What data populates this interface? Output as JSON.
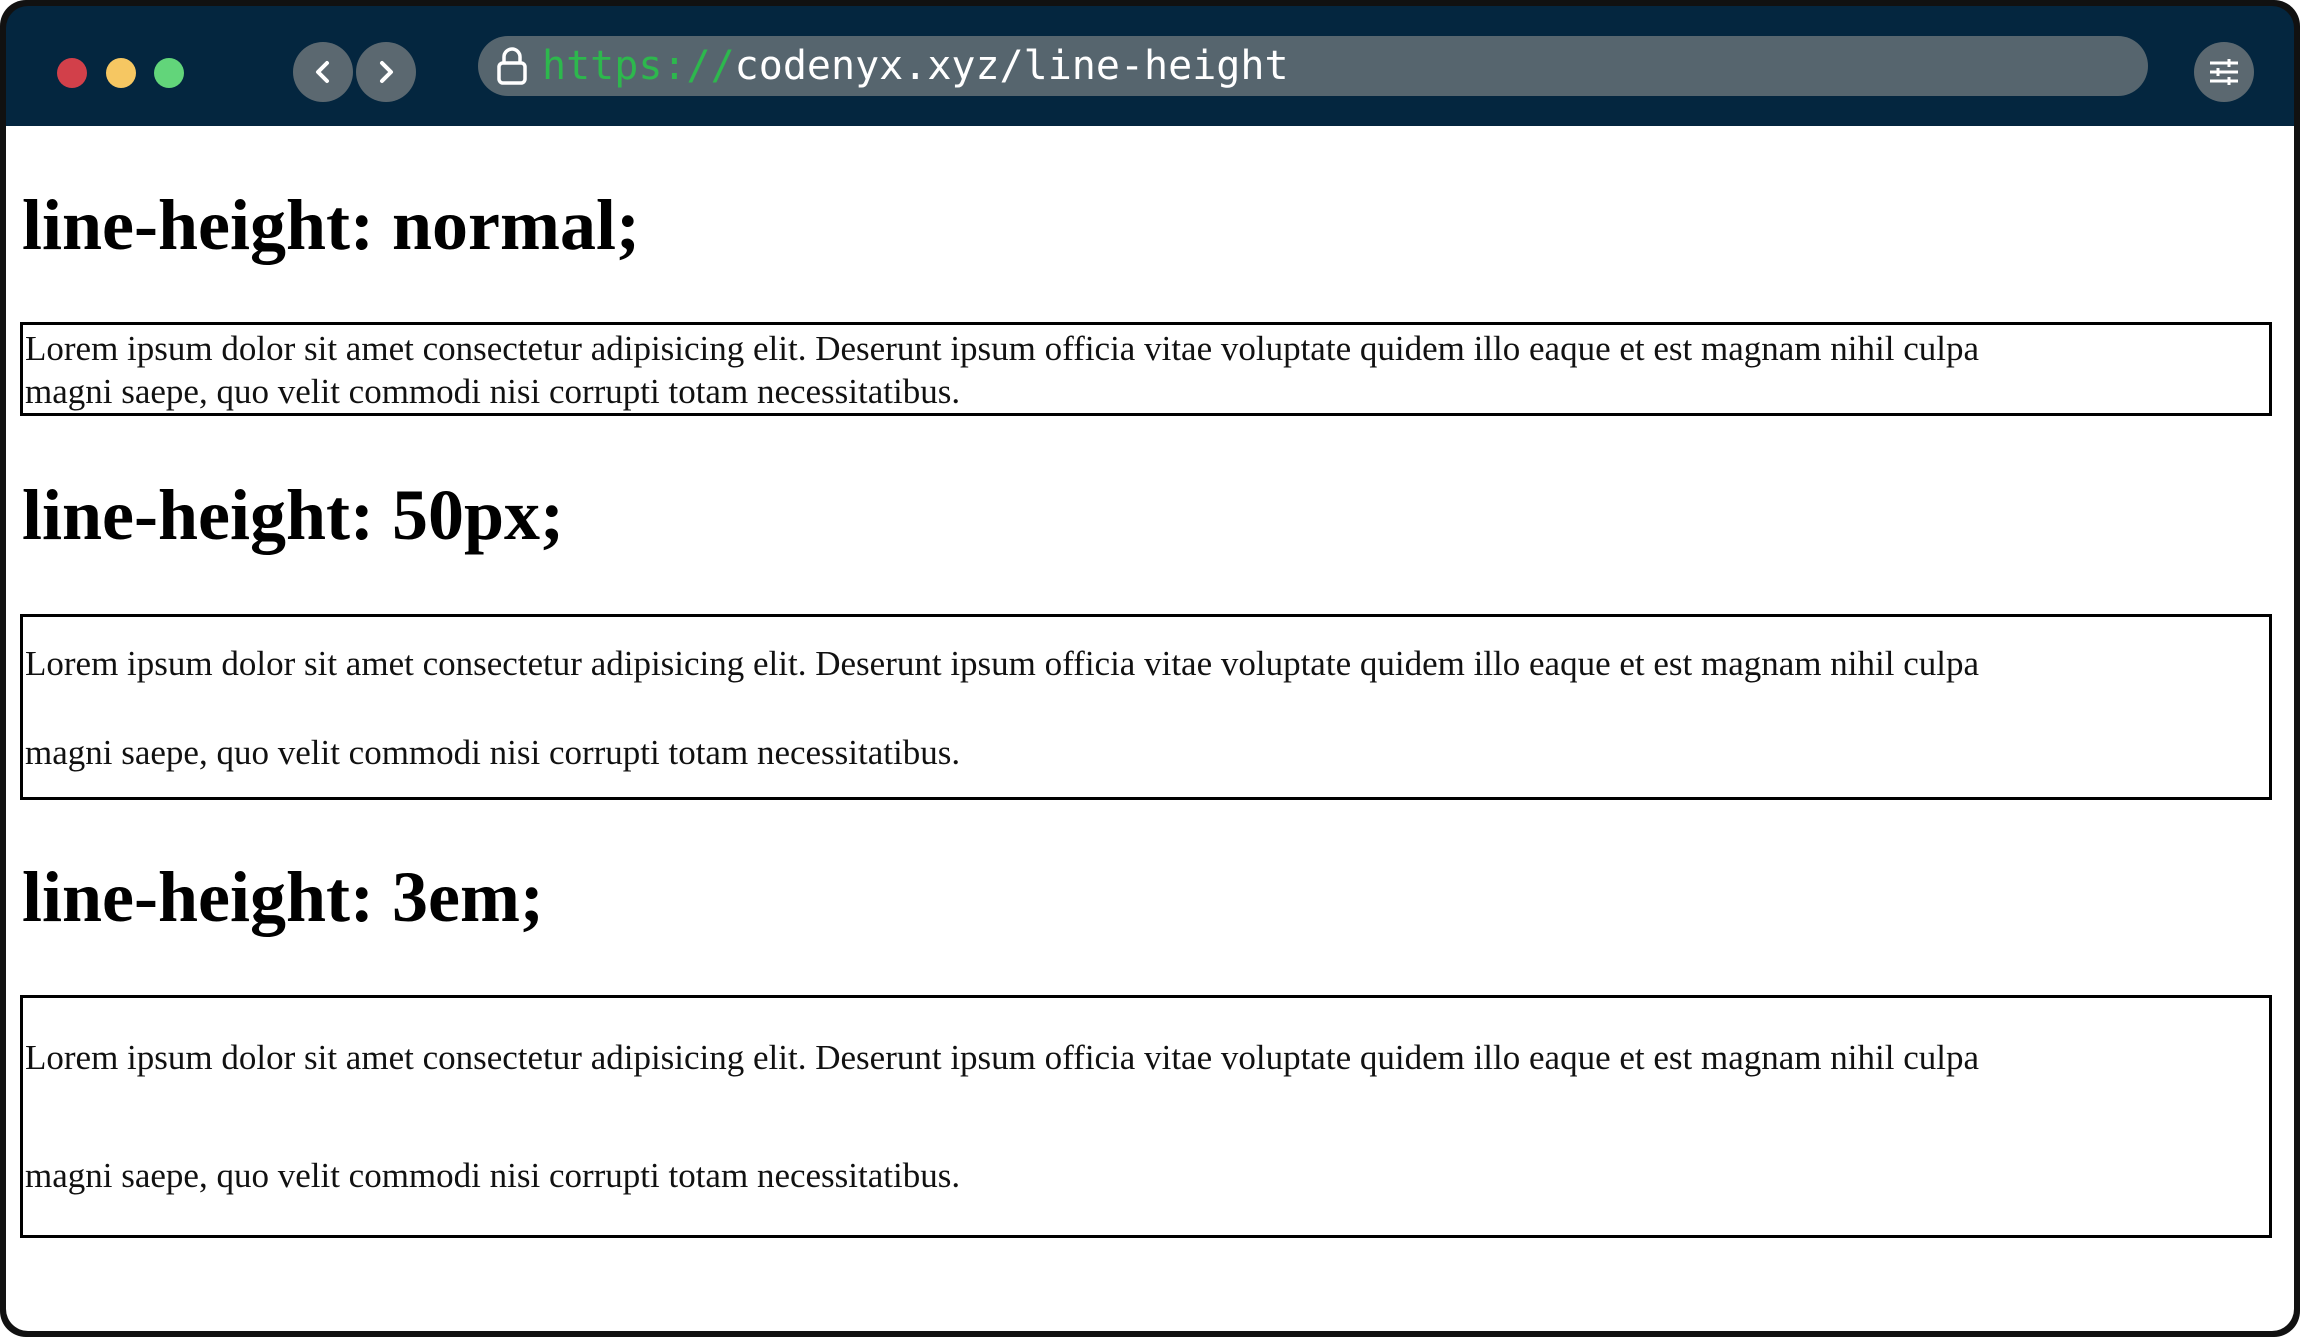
{
  "browser": {
    "url_scheme": "https://",
    "url_rest": "codenyx.xyz/line-height",
    "icons": [
      "back-icon",
      "forward-icon",
      "lock-icon",
      "settings-sliders-icon"
    ],
    "traffic_light_colors": [
      "#d2404a",
      "#f6c762",
      "#62d57a"
    ]
  },
  "sections": [
    {
      "heading": "line-height: normal;",
      "line1": "Lorem ipsum dolor sit amet consectetur adipisicing elit. Deserunt ipsum officia vitae voluptate quidem illo eaque et est magnam nihil culpa",
      "line2": "magni saepe, quo velit commodi nisi corrupti totam necessitatibus."
    },
    {
      "heading": "line-height: 50px;",
      "line1": "Lorem ipsum dolor sit amet consectetur adipisicing elit. Deserunt ipsum officia vitae voluptate quidem illo eaque et est magnam nihil culpa",
      "line2": "magni saepe, quo velit commodi nisi corrupti totam necessitatibus."
    },
    {
      "heading": "line-height: 3em;",
      "line1": "Lorem ipsum dolor sit amet consectetur adipisicing elit. Deserunt ipsum officia vitae voluptate quidem illo eaque et est magnam nihil culpa",
      "line2": "magni saepe, quo velit commodi nisi corrupti totam necessitatibus."
    }
  ]
}
